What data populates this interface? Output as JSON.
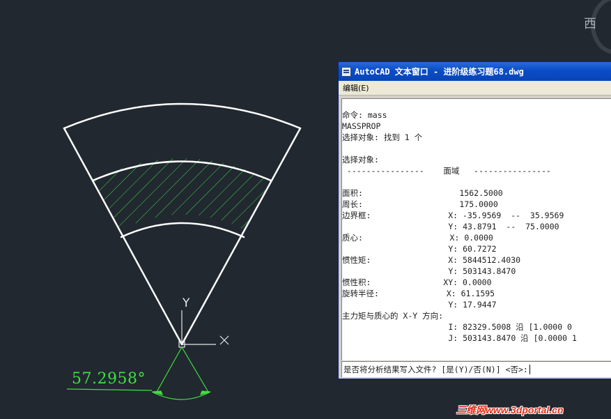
{
  "viewcube": {
    "direction_label": "西"
  },
  "drawing": {
    "dimension_text": "57.2958°",
    "ucs": {
      "y_label": "Y",
      "x_label": "X"
    },
    "colors": {
      "geometry": "#ffffff",
      "hatch": "#3fe03f",
      "dimension": "#3fe03f",
      "background": "#212830"
    }
  },
  "text_window": {
    "title": "AutoCAD 文本窗口 - 进阶级练习题68.dwg",
    "menu": {
      "edit": "编辑(E)"
    },
    "lines": [
      "命令: mass",
      "MASSPROP",
      "选择对象: 找到 1 个",
      "",
      "选择对象:",
      " ----------------    面域   ----------------",
      "",
      "面积:                    1562.5000",
      "周长:                    175.0000",
      "边界框:                X: -35.9569  --  35.9569",
      "                      Y: 43.8791  --  75.0000",
      "质心:                  X: 0.0000",
      "                      Y: 60.7272",
      "惯性矩:                X: 5844512.4030",
      "                      Y: 503143.8470",
      "惯性积:               XY: 0.0000",
      "旋转半径:              X: 61.1595",
      "                      Y: 17.9447",
      "主力矩与质心的 X-Y 方向:",
      "                      I: 82329.5008 沿 [1.0000 0",
      "                      J: 503143.8470 沿 [0.0000 1"
    ],
    "prompt": "是否将分析结果写入文件? [是(Y)/否(N)] <否>:"
  },
  "watermark": "三维网www.3dportal.cn"
}
